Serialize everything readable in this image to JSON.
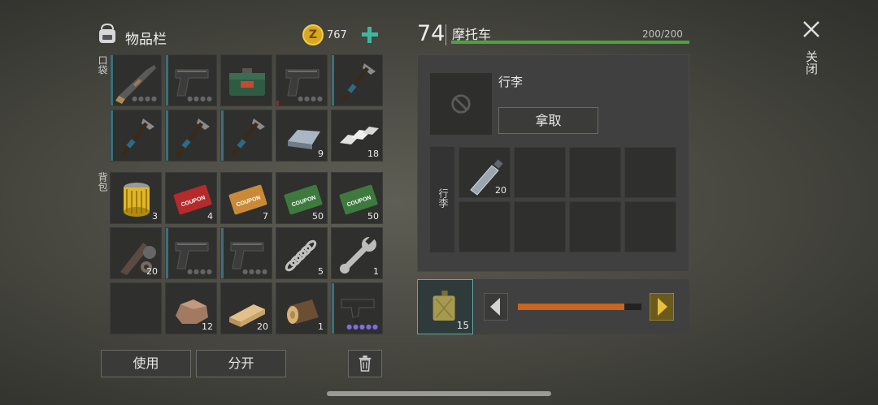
{
  "inventory": {
    "title": "物品栏",
    "coins": "767",
    "pocket_label": "口袋",
    "backpack_label": "背包",
    "use_label": "使用",
    "split_label": "分开",
    "pocket_slots": [
      {
        "name": "shotgun-icon",
        "count": "",
        "dots": "●●●●"
      },
      {
        "name": "pistol-icon",
        "count": "",
        "dots": "●●●●"
      },
      {
        "name": "toolbox-icon",
        "count": "",
        "dots": ""
      },
      {
        "name": "pistol-icon",
        "count": "",
        "dots": "●●●●"
      },
      {
        "name": "pickaxe-icon",
        "count": "",
        "dots": ""
      },
      {
        "name": "pickaxe-icon",
        "count": "",
        "dots": ""
      },
      {
        "name": "pickaxe-icon",
        "count": "",
        "dots": ""
      },
      {
        "name": "pickaxe-icon",
        "count": "",
        "dots": ""
      },
      {
        "name": "iron-ingot-icon",
        "count": "9",
        "dots": ""
      },
      {
        "name": "aluminum-ingot-icon",
        "count": "18",
        "dots": ""
      }
    ],
    "backpack_slots": [
      {
        "name": "oil-filter-icon",
        "count": "3",
        "dots": ""
      },
      {
        "name": "combat-gear-coupon-icon",
        "count": "4",
        "dots": "",
        "coupon": "COUPON"
      },
      {
        "name": "equipment-coupon-icon",
        "count": "7",
        "dots": "",
        "coupon": "COUPON"
      },
      {
        "name": "ration-coupon-icon",
        "count": "50",
        "dots": "",
        "coupon": "COUPON"
      },
      {
        "name": "ration-coupon-icon",
        "count": "50",
        "dots": "",
        "coupon": "COUPON"
      },
      {
        "name": "vehicle-parts-icon",
        "count": "20",
        "dots": ""
      },
      {
        "name": "pistol-icon",
        "count": "",
        "dots": "●●●●"
      },
      {
        "name": "pistol-icon",
        "count": "",
        "dots": "●●●●"
      },
      {
        "name": "spring-icon",
        "count": "5",
        "dots": ""
      },
      {
        "name": "wrench-icon",
        "count": "1",
        "dots": ""
      },
      {
        "name": "empty-slot",
        "count": "",
        "dots": ""
      },
      {
        "name": "stone-icon",
        "count": "12",
        "dots": ""
      },
      {
        "name": "plank-icon",
        "count": "20",
        "dots": ""
      },
      {
        "name": "log-icon",
        "count": "1",
        "dots": ""
      },
      {
        "name": "smg-icon",
        "count": "",
        "dots": "●●●●●"
      }
    ]
  },
  "vehicle": {
    "level": "74",
    "name": "摩托车",
    "health": "200/200",
    "health_fraction": 1.0,
    "trunk_title": "行李",
    "take_label": "拿取",
    "trunk_side_label": "行李",
    "trunk_slots": [
      {
        "name": "water-bottle-icon",
        "count": "20"
      },
      {
        "name": "empty-slot",
        "count": ""
      },
      {
        "name": "empty-slot",
        "count": ""
      },
      {
        "name": "empty-slot",
        "count": ""
      },
      {
        "name": "empty-slot",
        "count": ""
      },
      {
        "name": "empty-slot",
        "count": ""
      },
      {
        "name": "empty-slot",
        "count": ""
      },
      {
        "name": "empty-slot",
        "count": ""
      }
    ],
    "fuel_count": "15",
    "fuel_fraction": 0.86
  },
  "close_label": "关闭",
  "colors": {
    "health": "#4aa43c",
    "fuel": "#c8651e",
    "accent": "#3fb7a0",
    "coin": "#e0b22a"
  }
}
